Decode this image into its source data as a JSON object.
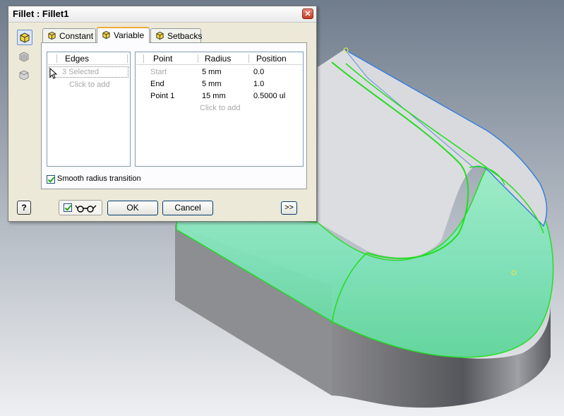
{
  "dialog": {
    "title": "Fillet : Fillet1",
    "close_glyph": "✕",
    "side_icons": [
      "edge-fillet-icon",
      "face-fillet-icon",
      "full-round-fillet-icon"
    ],
    "tabs": [
      {
        "label": "Constant",
        "icon": "cube-icon",
        "active": false
      },
      {
        "label": "Variable",
        "icon": "cube-icon",
        "active": true
      },
      {
        "label": "Setbacks",
        "icon": "cube-icon",
        "active": false
      }
    ],
    "edges": {
      "header": "Edges",
      "selected": "3 Selected",
      "click_to_add": "Click to add"
    },
    "points": {
      "headers": [
        "Point",
        "Radius",
        "Position"
      ],
      "rows": [
        {
          "point": "Start",
          "radius": "5 mm",
          "position": "0.0",
          "dim": true
        },
        {
          "point": "End",
          "radius": "5 mm",
          "position": "1.0",
          "dim": false
        },
        {
          "point": "Point 1",
          "radius": "15 mm",
          "position": "0.5000 ul",
          "dim": false
        }
      ],
      "click_to_add": "Click to add"
    },
    "smooth_transition": {
      "label": "Smooth radius transition",
      "checked": true
    },
    "buttons": {
      "help": "?",
      "ok": "OK",
      "cancel": "Cancel",
      "more": ">>"
    },
    "preview_checked": true
  },
  "colors": {
    "dialog_bg": "#ece9d8",
    "accent_tab": "#f1a93a",
    "fillet_green": "#22dd22",
    "edge_blue": "#3a7fd9"
  }
}
